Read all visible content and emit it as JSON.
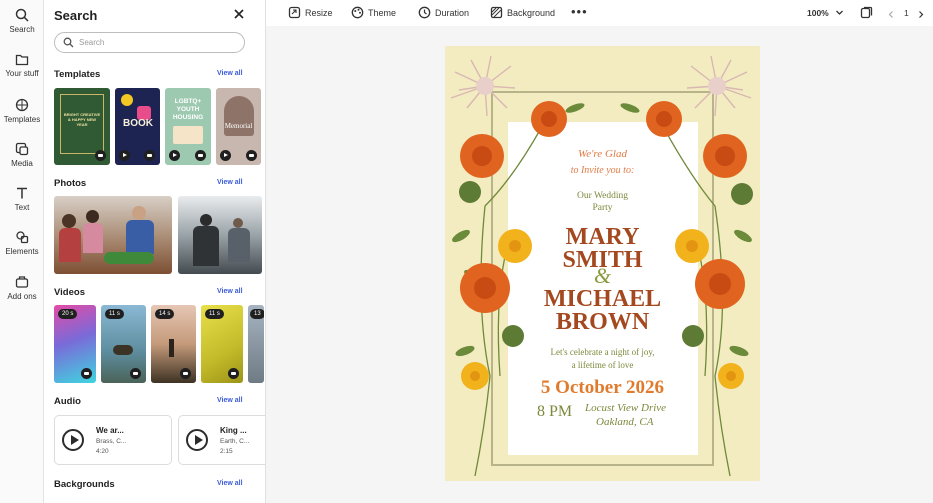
{
  "rail": [
    {
      "label": "Search",
      "icon": "search-icon"
    },
    {
      "label": "Your stuff",
      "icon": "folder-icon"
    },
    {
      "label": "Templates",
      "icon": "templates-icon"
    },
    {
      "label": "Media",
      "icon": "media-icon"
    },
    {
      "label": "Text",
      "icon": "text-icon"
    },
    {
      "label": "Elements",
      "icon": "elements-icon"
    },
    {
      "label": "Add ons",
      "icon": "add-ons-icon"
    }
  ],
  "panel": {
    "title": "Search",
    "search_placeholder": "Search",
    "view_all": "View all",
    "sections": {
      "templates": "Templates",
      "photos": "Photos",
      "videos": "Videos",
      "audio": "Audio",
      "backgrounds": "Backgrounds"
    },
    "template_thumbs": [
      {
        "text": "BRIGHT CREATIVE & HAPPY NEW YEAR"
      },
      {
        "text": "BOOK"
      },
      {
        "text": "LGBTQ+ YOUTH HOUSING"
      },
      {
        "text": "Memorial"
      }
    ],
    "videos": [
      {
        "duration": "20 s"
      },
      {
        "duration": "11 s"
      },
      {
        "duration": "14 s"
      },
      {
        "duration": "11 s"
      },
      {
        "duration": "13"
      }
    ],
    "audio": [
      {
        "title": "We ar...",
        "genre": "Brass, C...",
        "duration": "4:20"
      },
      {
        "title": "King ...",
        "genre": "Earth, C...",
        "duration": "2:15"
      }
    ]
  },
  "toolbar": {
    "resize": "Resize",
    "theme": "Theme",
    "duration": "Duration",
    "background": "Background",
    "zoom": "100%",
    "page": "1"
  },
  "invite": {
    "line1": "We're Glad",
    "line2": "to Invite you to:",
    "event1": "Our Wedding",
    "event2": "Party",
    "name1a": "MARY",
    "name1b": "SMITH",
    "amp": "&",
    "name2a": "MICHAEL",
    "name2b": "BROWN",
    "msg1": "Let's celebrate a night of joy,",
    "msg2": "a lifetime of love",
    "date": "5 October 2026",
    "time": "8 PM",
    "venue1": "Locust View Drive",
    "venue2": "Oakland, CA"
  },
  "colors": {
    "accent_blue": "#3b5bd6",
    "card_bg": "#f3ecc0",
    "names": "#a4481f",
    "green": "#7b8a3c",
    "orange": "#e07a2c"
  }
}
